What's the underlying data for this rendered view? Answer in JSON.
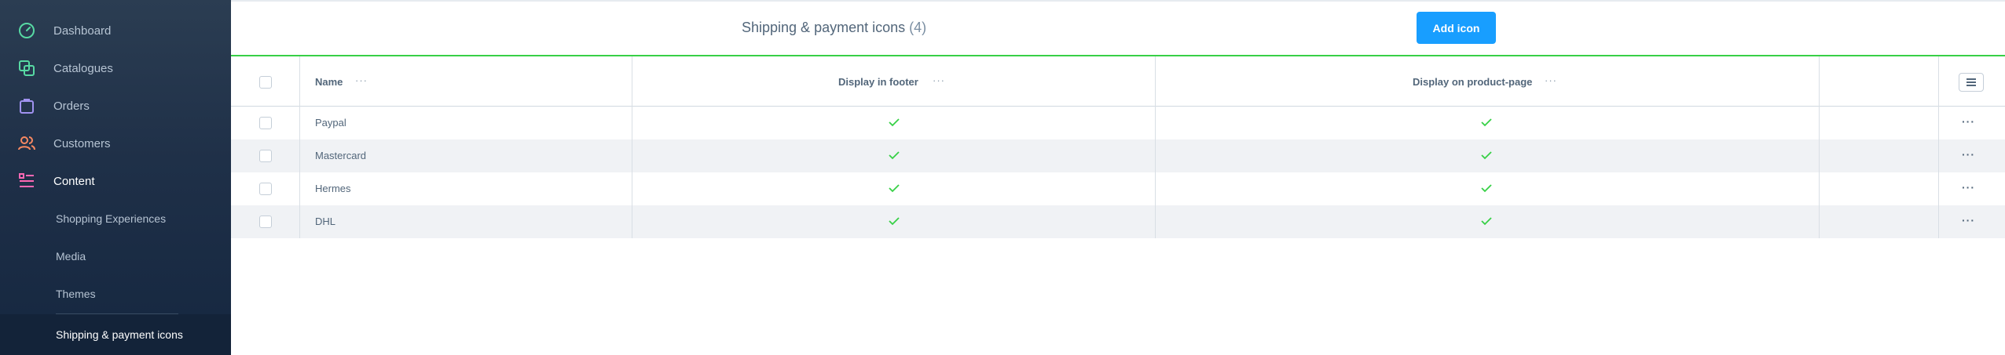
{
  "sidebar": {
    "items": [
      {
        "label": "Dashboard",
        "icon": "dashboard-icon",
        "color": "#57d9a3"
      },
      {
        "label": "Catalogues",
        "icon": "catalogues-icon",
        "color": "#57d9a3"
      },
      {
        "label": "Orders",
        "icon": "orders-icon",
        "color": "#a092f0"
      },
      {
        "label": "Customers",
        "icon": "customers-icon",
        "color": "#f88962"
      },
      {
        "label": "Content",
        "icon": "content-icon",
        "color": "#ff68b4"
      }
    ],
    "sub_items": [
      {
        "label": "Shopping Experiences"
      },
      {
        "label": "Media"
      },
      {
        "label": "Themes"
      },
      {
        "label": "Shipping & payment icons"
      }
    ]
  },
  "header": {
    "title": "Shipping & payment icons",
    "count": "(4)",
    "add_button": "Add icon"
  },
  "grid": {
    "columns": [
      "Name",
      "Display in footer",
      "Display on product-page"
    ],
    "rows": [
      {
        "name": "Paypal",
        "footer": true,
        "product_page": true
      },
      {
        "name": "Mastercard",
        "footer": true,
        "product_page": true
      },
      {
        "name": "Hermes",
        "footer": true,
        "product_page": true
      },
      {
        "name": "DHL",
        "footer": true,
        "product_page": true
      }
    ],
    "check_color": "#37d046"
  },
  "colors": {
    "accent": "#189eff",
    "header_underline": "#37d046"
  }
}
